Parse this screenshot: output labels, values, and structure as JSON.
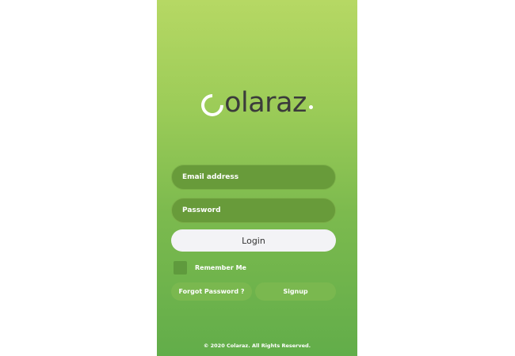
{
  "brand": {
    "logo_text": "colaraz",
    "logo_rest": "olaraz"
  },
  "form": {
    "email_placeholder": "Email address",
    "password_placeholder": "Password",
    "login_label": "Login",
    "remember_label": "Remember Me",
    "remember_checked": false
  },
  "links": {
    "forgot_label": "Forgot Password ?",
    "signup_label": "Signup"
  },
  "footer": {
    "copyright": "© 2020 Colaraz. All Rights Reserved."
  },
  "colors": {
    "gradient_top": "#b6d864",
    "gradient_bottom": "#62ad4a",
    "field_bg": "#689b3a",
    "button_bg": "#f3f3f6",
    "pill_bg": "#7ab84f",
    "logo_dark": "#3b3b3b",
    "accent_white": "#ffffff"
  }
}
